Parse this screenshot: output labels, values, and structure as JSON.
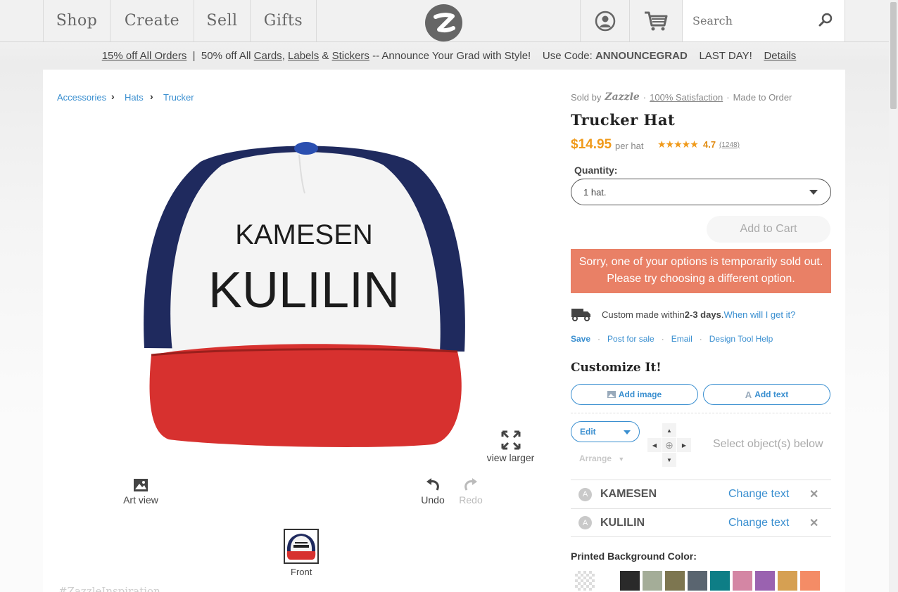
{
  "nav": {
    "shop": "Shop",
    "create": "Create",
    "sell": "Sell",
    "gifts": "Gifts",
    "search_placeholder": "Search"
  },
  "promo": {
    "part1": "15% off All Orders",
    "sep1": "  |  50% off All ",
    "cards": "Cards",
    "comma": ", ",
    "labels": "Labels",
    "amp": " & ",
    "stickers": "Stickers",
    "tail": " -- Announce Your Grad with Style!    Use Code: ",
    "code": "ANNOUNCEGRAD",
    "lastday": "    LAST DAY!    ",
    "details": "Details"
  },
  "breadcrumb": {
    "items": [
      "Accessories",
      "Hats",
      "Trucker"
    ]
  },
  "product": {
    "sold_by": "Sold by",
    "brand": "Zazzle",
    "satisfaction": "100% Satisfaction",
    "made": "Made to Order",
    "title": "Trucker Hat",
    "price": "$14.95",
    "per": "per hat",
    "stars": "★★★★★",
    "rating": "4.7",
    "rating_count": "(1248)",
    "quantity_label": "Quantity:",
    "quantity_value": "1 hat.",
    "add_to_cart": "Add to Cart",
    "soldout_line1": "Sorry, one of your options is temporarily sold out.",
    "soldout_line2": "Please try choosing a different option.",
    "delivery_pre": "Custom made within ",
    "delivery_days": "2-3 days",
    "delivery_dot": ". ",
    "delivery_link": "When will I get it?",
    "actions": {
      "save": "Save",
      "post": "Post for sale",
      "email": "Email",
      "help": "Design Tool Help"
    }
  },
  "customize": {
    "title": "Customize It!",
    "add_image": "Add image",
    "add_text": "Add text",
    "edit": "Edit",
    "arrange": "Arrange",
    "select_hint": "Select object(s) below",
    "objects": [
      {
        "icon": "A",
        "name": "KAMESEN",
        "action": "Change text",
        "remove": "✕"
      },
      {
        "icon": "A",
        "name": "KULILIN",
        "action": "Change text",
        "remove": "✕"
      }
    ],
    "bg_title": "Printed Background Color:",
    "swatches": [
      "#2a2a2a",
      "#a4ad98",
      "#7d7650",
      "#5a6570",
      "#0e7e86",
      "#d486a4",
      "#9a62b0",
      "#d6a052",
      "#f48c66"
    ]
  },
  "preview": {
    "line1": "KAMESEN",
    "line2": "KULILIN",
    "view_larger": "view larger",
    "art_view": "Art view",
    "undo": "Undo",
    "redo": "Redo",
    "front": "Front",
    "footer_text": "#ZazzleInspiration"
  }
}
